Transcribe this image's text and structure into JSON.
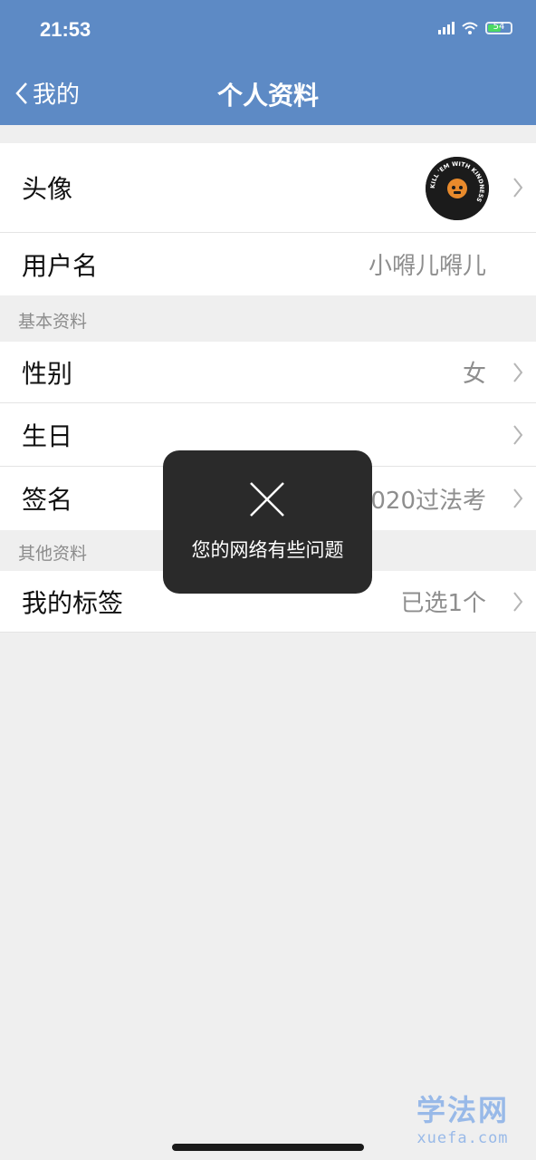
{
  "status": {
    "time": "21:53",
    "battery_label": "54"
  },
  "nav": {
    "back_label": "我的",
    "title": "个人资料"
  },
  "profile": {
    "avatar_label": "头像",
    "avatar_ring_text": "KILL 'EM WITH KINDNESS",
    "username_label": "用户名",
    "username_value": "小嘚儿嘚儿"
  },
  "basic": {
    "section_title": "基本资料",
    "gender_label": "性别",
    "gender_value": "女",
    "birthday_label": "生日",
    "birthday_value": "",
    "signature_label": "签名",
    "signature_value": "020过法考"
  },
  "other": {
    "section_title": "其他资料",
    "tags_label": "我的标签",
    "tags_value": "已选1个"
  },
  "toast": {
    "message": "您的网络有些问题"
  },
  "watermark": {
    "name": "学法网",
    "url": "xuefa.com"
  },
  "colors": {
    "header": "#5d8ac5",
    "background": "#efefef",
    "toast": "#2a2a2a"
  }
}
